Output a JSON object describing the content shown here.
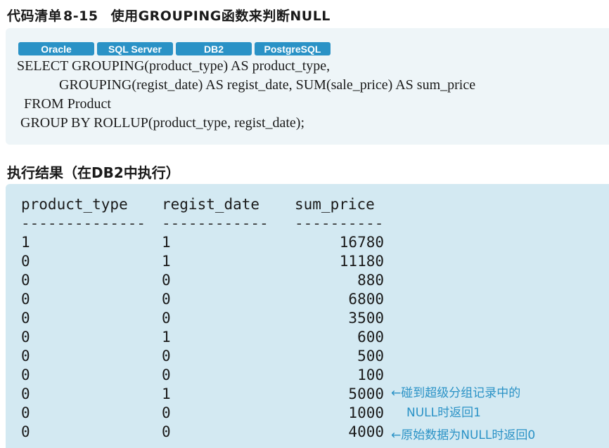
{
  "title": {
    "label": "代码清单",
    "number": "8-15",
    "text": "使用GROUPING函数来判断NULL"
  },
  "tags": [
    "Oracle",
    "SQL Server",
    "DB2",
    "PostgreSQL"
  ],
  "code_lines": [
    "SELECT GROUPING(product_type) AS product_type,",
    "            GROUPING(regist_date) AS regist_date, SUM(sale_price) AS sum_price",
    "  FROM Product",
    " GROUP BY ROLLUP(product_type, regist_date);"
  ],
  "result": {
    "heading": "执行结果（在DB2中执行）",
    "columns": [
      "product_type",
      "regist_date",
      "sum_price"
    ],
    "separators": [
      "--------------",
      "------------",
      "----------"
    ],
    "rows": [
      [
        "1",
        "1",
        "16780"
      ],
      [
        "0",
        "1",
        "11180"
      ],
      [
        "0",
        "0",
        "880"
      ],
      [
        "0",
        "0",
        "6800"
      ],
      [
        "0",
        "0",
        "3500"
      ],
      [
        "0",
        "1",
        "600"
      ],
      [
        "0",
        "0",
        "500"
      ],
      [
        "0",
        "0",
        "100"
      ],
      [
        "0",
        "1",
        "5000"
      ],
      [
        "0",
        "0",
        "1000"
      ],
      [
        "0",
        "0",
        "4000"
      ]
    ],
    "notes": [
      {
        "line1": "←碰到超级分组记录中的",
        "line2": "NULL时返回1"
      },
      {
        "line1": "←原始数据为NULL时返回0"
      }
    ]
  }
}
